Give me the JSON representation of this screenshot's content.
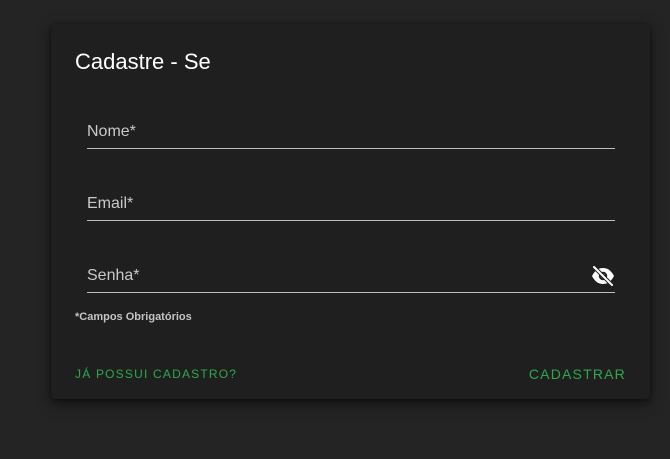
{
  "form": {
    "title": "Cadastre - Se",
    "fields": [
      {
        "label": "Nome*",
        "value": ""
      },
      {
        "label": "Email*",
        "value": ""
      },
      {
        "label": "Senha*",
        "value": ""
      }
    ],
    "password_toggle_icon": "eye-off-icon",
    "required_note": "*Campos Obrigatórios",
    "login_link_label": "JÁ POSSUI CADASTRO?",
    "submit_label": "CADASTRAR"
  },
  "colors": {
    "background": "#242424",
    "card": "#1f1f1f",
    "accent": "#2ea84f",
    "text": "#ffffff",
    "label": "#c9c9c9",
    "underline": "#bdbdbd"
  }
}
